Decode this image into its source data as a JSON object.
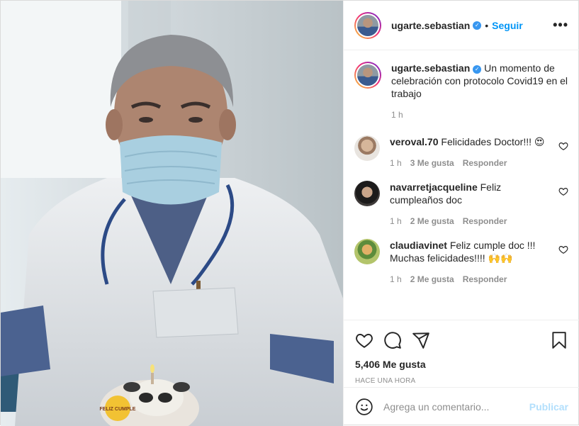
{
  "post": {
    "username": "ugarte.sebastian",
    "verified_icon": "verified-badge-icon",
    "follow_label": "Seguir",
    "separator": "•",
    "more_icon": "more-options-icon",
    "more_label": "•••"
  },
  "caption": {
    "username": "ugarte.sebastian",
    "text": "Un momento de celebración con protocolo Covid19 en el trabajo",
    "time": "1 h"
  },
  "comments": [
    {
      "username": "veroval.70",
      "text": "Felicidades Doctor!!! 😍",
      "time": "1 h",
      "likes": "3 Me gusta",
      "reply": "Responder"
    },
    {
      "username": "navarretjacqueline",
      "text": "Feliz cumpleaños doc",
      "time": "1 h",
      "likes": "2 Me gusta",
      "reply": "Responder"
    },
    {
      "username": "claudiavinet",
      "text": "Feliz cumple doc !!! Muchas felicidades!!!! 🙌🙌",
      "time": "1 h",
      "likes": "2 Me gusta",
      "reply": "Responder"
    }
  ],
  "actions": {
    "like_icon": "heart-icon",
    "comment_icon": "comment-icon",
    "share_icon": "share-icon",
    "save_icon": "bookmark-icon",
    "likes_count": "5,406 Me gusta",
    "time_ago": "HACE UNA HORA"
  },
  "comment_box": {
    "emoji_icon": "emoji-icon",
    "placeholder": "Agrega un comentario...",
    "publish_label": "Publicar"
  },
  "photo": {
    "cake_text": "FELIZ CUMPLE"
  },
  "colors": {
    "accent": "#0095f6",
    "verified": "#3897f0",
    "muted": "#8e8e8e",
    "publish_disabled": "#b2dffc"
  }
}
